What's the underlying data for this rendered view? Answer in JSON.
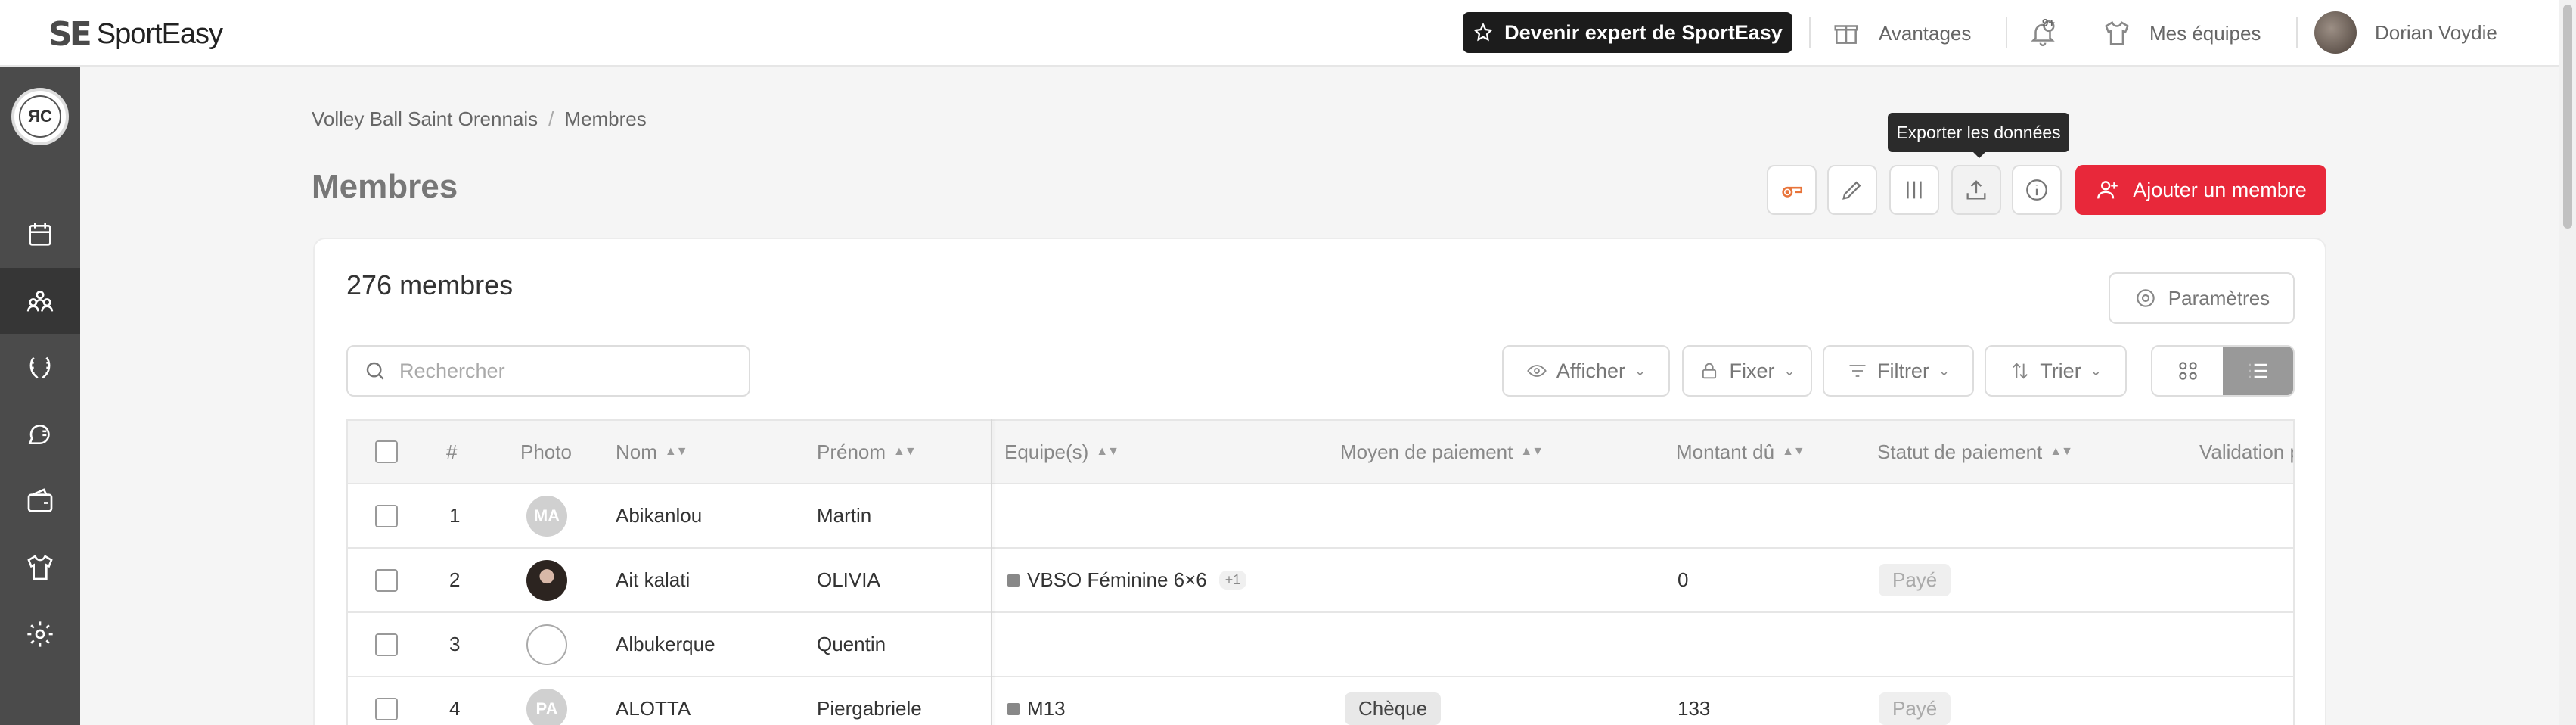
{
  "topbar": {
    "logo_mark": "SE",
    "logo_text": "SportEasy",
    "expert_label": "Devenir expert de SportEasy",
    "advantages_label": "Avantages",
    "notif_badge": "9+",
    "my_teams_label": "Mes équipes",
    "user_name": "Dorian Voydie"
  },
  "sidebar": {
    "club_initials": "ЯС",
    "items": [
      "calendar-icon",
      "members-icon",
      "laurel-icon",
      "chat-icon",
      "wallet-icon",
      "jersey-icon",
      "gear-icon"
    ],
    "active": "members-icon"
  },
  "breadcrumb": {
    "club": "Volley Ball Saint Orennais",
    "separator": "/",
    "current": "Membres"
  },
  "page": {
    "title": "Membres",
    "tooltip": "Exporter les données",
    "add_member_label": "Ajouter un membre"
  },
  "card": {
    "count": "276 membres",
    "params_label": "Paramètres",
    "search_placeholder": "Rechercher",
    "filters": {
      "show": "Afficher",
      "pin": "Fixer",
      "filter": "Filtrer",
      "sort": "Trier"
    }
  },
  "table": {
    "headers": {
      "num": "#",
      "photo": "Photo",
      "nom": "Nom",
      "prenom": "Prénom",
      "equipes": "Equipe(s)",
      "moyen": "Moyen de paiement",
      "montant": "Montant dû",
      "statut": "Statut de paiement",
      "validation": "Validation pa"
    },
    "rows": [
      {
        "num": "1",
        "initials": "MA",
        "nom": "Abikanlou",
        "prenom": "Martin",
        "team": "",
        "extra": "",
        "moyen": "",
        "montant": "",
        "statut": ""
      },
      {
        "num": "2",
        "initials": "",
        "nom": "Ait kalati",
        "prenom": "OLIVIA",
        "team": "VBSO Féminine 6×6",
        "extra": "+1",
        "moyen": "",
        "montant": "0",
        "statut": "Payé"
      },
      {
        "num": "3",
        "initials": "",
        "nom": "Albukerque",
        "prenom": "Quentin",
        "team": "",
        "extra": "",
        "moyen": "",
        "montant": "",
        "statut": ""
      },
      {
        "num": "4",
        "initials": "PA",
        "nom": "ALOTTA",
        "prenom": "Piergabriele",
        "team": "M13",
        "extra": "",
        "moyen": "Chèque",
        "montant": "133",
        "statut": "Payé"
      }
    ]
  }
}
